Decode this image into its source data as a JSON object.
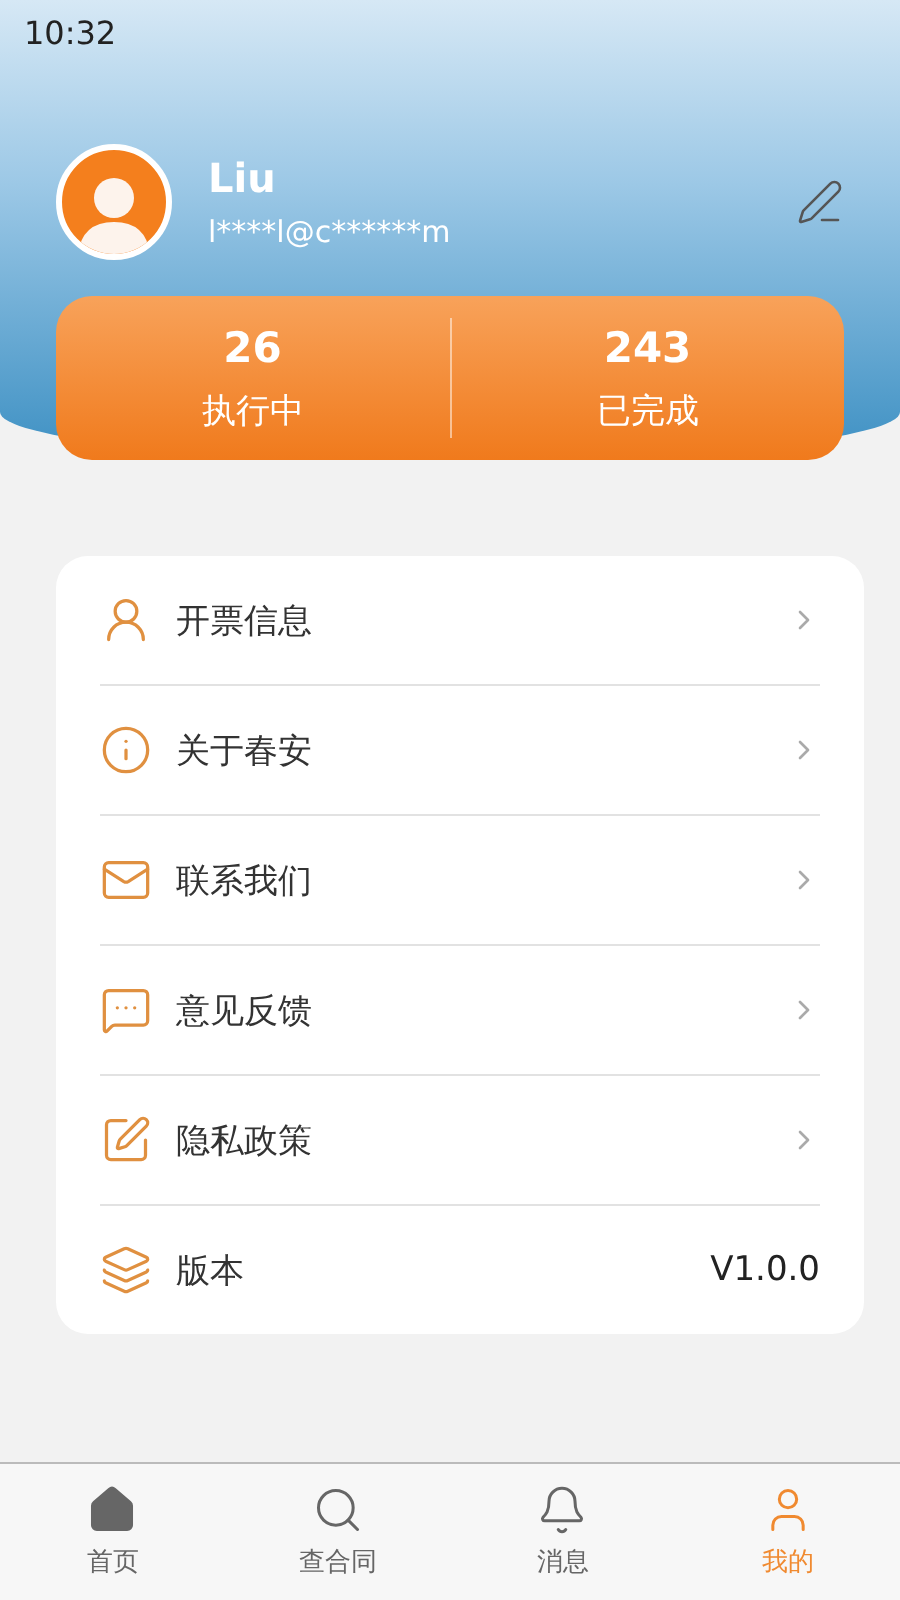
{
  "status_bar": {
    "time": "10:32"
  },
  "profile": {
    "name": "Liu",
    "account": "l****l@c******m"
  },
  "stats": [
    {
      "value": "26",
      "label": "执行中"
    },
    {
      "value": "243",
      "label": "已完成"
    }
  ],
  "menu": [
    {
      "kind": "link",
      "label": "开票信息"
    },
    {
      "kind": "link",
      "label": "关于春安"
    },
    {
      "kind": "link",
      "label": "联系我们"
    },
    {
      "kind": "link",
      "label": "意见反馈"
    },
    {
      "kind": "link",
      "label": "隐私政策"
    },
    {
      "kind": "value",
      "label": "版本",
      "value": "V1.0.0"
    }
  ],
  "tab_bar": [
    {
      "label": "首页",
      "selected": false
    },
    {
      "label": "查合同",
      "selected": false
    },
    {
      "label": "消息",
      "selected": false
    },
    {
      "label": "我的",
      "selected": true
    }
  ]
}
